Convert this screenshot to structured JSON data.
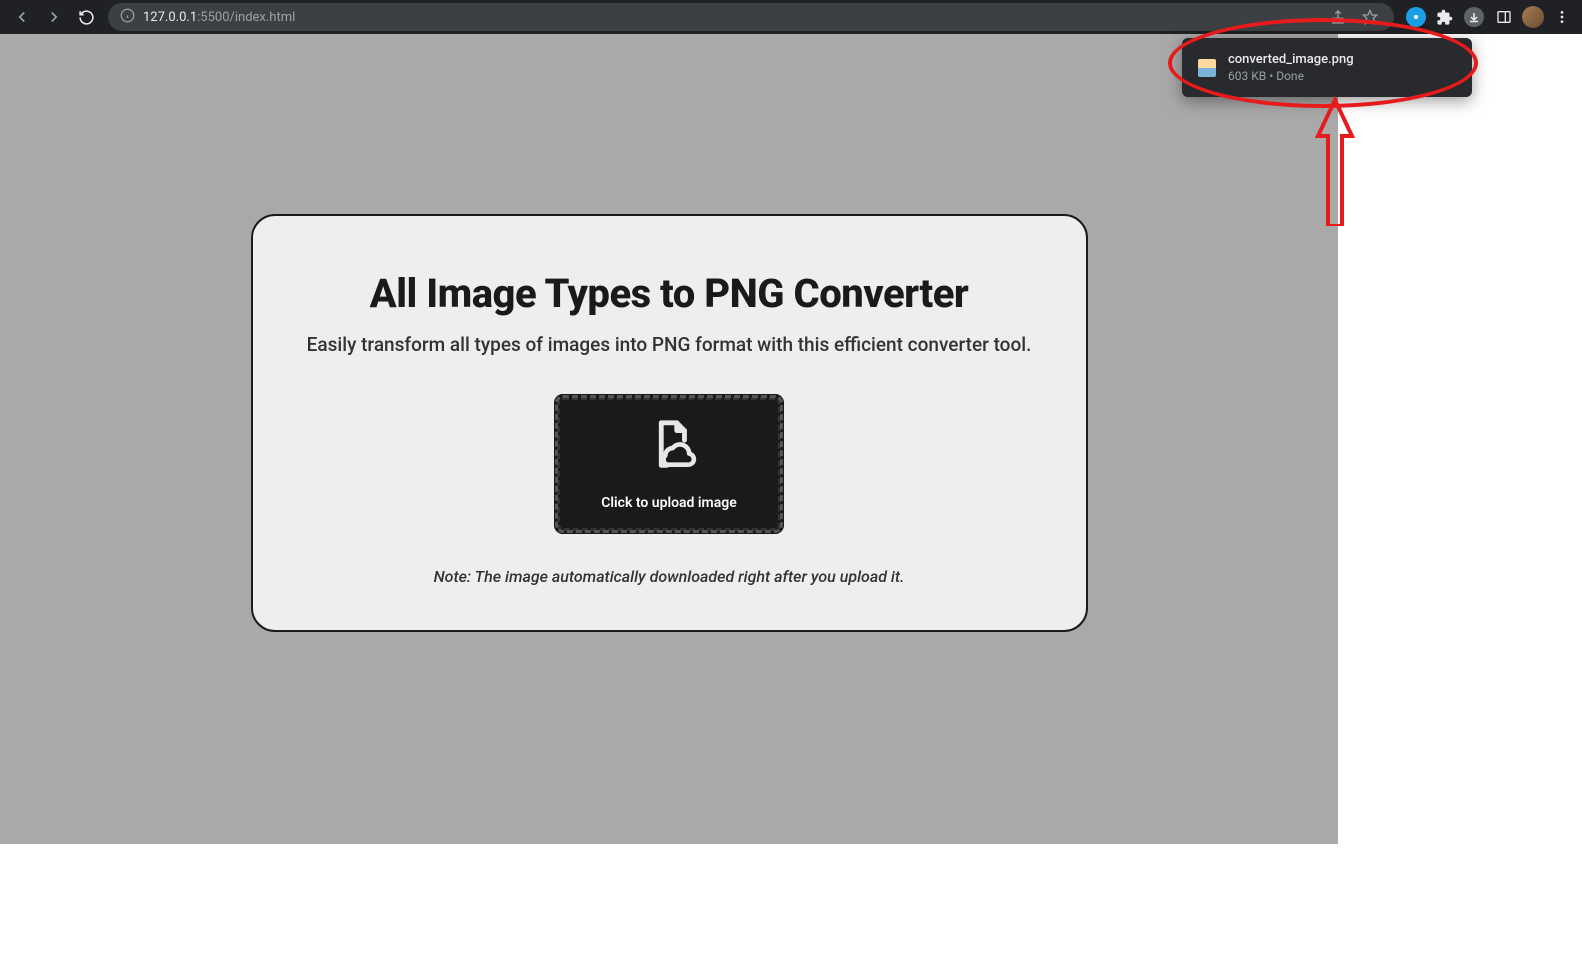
{
  "browser": {
    "url_host": "127.0.0.1",
    "url_path": ":5500/index.html"
  },
  "download": {
    "file_name": "converted_image.png",
    "file_meta": "603 KB • Done"
  },
  "card": {
    "title": "All Image Types to PNG Converter",
    "subtitle": "Easily transform all types of images into PNG format with this efficient converter tool.",
    "upload_label": "Click to upload image",
    "note": "Note: The image automatically downloaded right after you upload it."
  }
}
